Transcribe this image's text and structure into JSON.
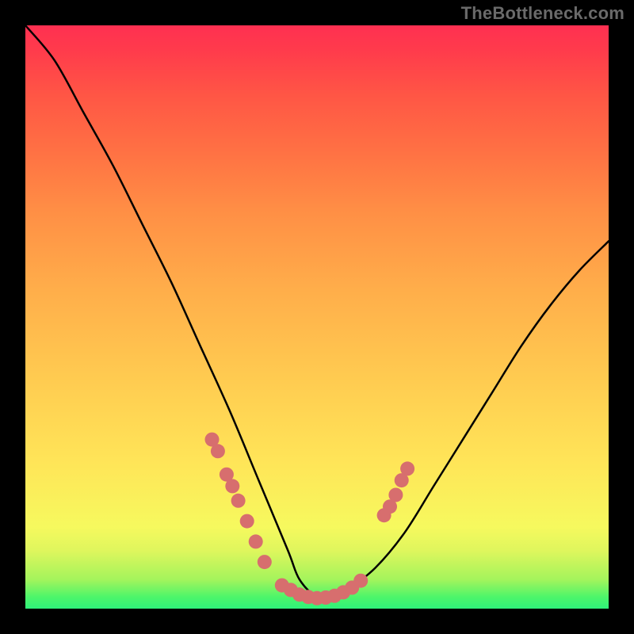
{
  "watermark": "TheBottleneck.com",
  "colors": {
    "curve": "#000000",
    "marker": "#d76e6e",
    "gradient_top": "#ff3051",
    "gradient_mid": "#ffd452",
    "gradient_bottom": "#2ff27a"
  },
  "chart_data": {
    "type": "line",
    "title": "",
    "xlabel": "",
    "ylabel": "",
    "xlim": [
      0,
      100
    ],
    "ylim": [
      0,
      100
    ],
    "legend": false,
    "series": [
      {
        "name": "bottleneck-curve",
        "x": [
          0,
          5,
          10,
          15,
          20,
          25,
          30,
          35,
          40,
          45,
          47,
          50,
          53,
          55,
          60,
          65,
          70,
          75,
          80,
          85,
          90,
          95,
          100
        ],
        "values": [
          100,
          94,
          85,
          76,
          66,
          56,
          45,
          34,
          22,
          10,
          5,
          2,
          2,
          3,
          7,
          13,
          21,
          29,
          37,
          45,
          52,
          58,
          63
        ]
      }
    ],
    "markers": [
      {
        "x": 32,
        "y": 29
      },
      {
        "x": 33,
        "y": 27
      },
      {
        "x": 34.5,
        "y": 23
      },
      {
        "x": 35.5,
        "y": 21
      },
      {
        "x": 36.5,
        "y": 18.5
      },
      {
        "x": 38,
        "y": 15
      },
      {
        "x": 39.5,
        "y": 11.5
      },
      {
        "x": 41,
        "y": 8
      },
      {
        "x": 44,
        "y": 4
      },
      {
        "x": 45.5,
        "y": 3.2
      },
      {
        "x": 47,
        "y": 2.4
      },
      {
        "x": 48.5,
        "y": 2
      },
      {
        "x": 50,
        "y": 1.8
      },
      {
        "x": 51.5,
        "y": 1.9
      },
      {
        "x": 53,
        "y": 2.2
      },
      {
        "x": 54.5,
        "y": 2.8
      },
      {
        "x": 56,
        "y": 3.6
      },
      {
        "x": 57.5,
        "y": 4.8
      },
      {
        "x": 61.5,
        "y": 16
      },
      {
        "x": 62.5,
        "y": 17.5
      },
      {
        "x": 63.5,
        "y": 19.5
      },
      {
        "x": 64.5,
        "y": 22
      },
      {
        "x": 65.5,
        "y": 24
      }
    ]
  }
}
